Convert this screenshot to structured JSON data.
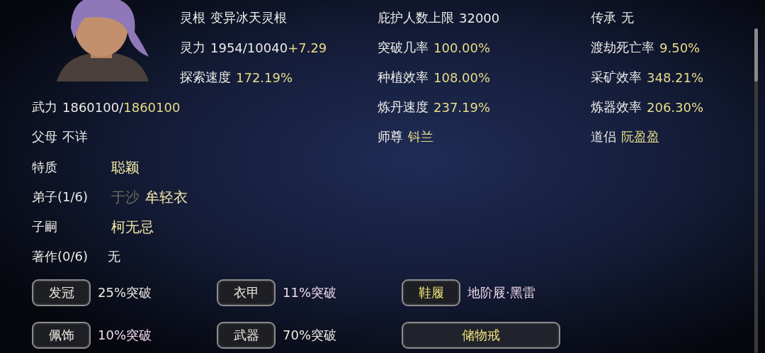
{
  "left_stats": [
    {
      "label": "灵根",
      "value": "变异冰天灵根"
    },
    {
      "label": "灵力",
      "value": "1954/10040",
      "accent": "+7.29"
    },
    {
      "label": "探索速度",
      "accent": "172.19%"
    },
    {
      "label": "武力",
      "value": "1860100/",
      "accent": "1860100"
    },
    {
      "label": "父母",
      "value": "不详"
    }
  ],
  "middle_stats": [
    {
      "label": "庇护人数上限",
      "value": "32000"
    },
    {
      "label": "突破几率",
      "accent": "100.00%"
    },
    {
      "label": "种植效率",
      "accent": "108.00%"
    },
    {
      "label": "炼丹速度",
      "accent": "237.19%"
    },
    {
      "label": "师尊",
      "accent": "钭兰"
    }
  ],
  "right_stats": [
    {
      "label": "传承",
      "value": "无"
    },
    {
      "label": "渡劫死亡率",
      "accent": "9.50%"
    },
    {
      "label": "采矿效率",
      "accent": "348.21%"
    },
    {
      "label": "炼器效率",
      "accent": "206.30%"
    },
    {
      "label": "道侣",
      "accent": "阮盈盈"
    }
  ],
  "relations": [
    {
      "label": "特质",
      "names": [
        {
          "text": "聪颖",
          "dimmed": false
        }
      ]
    },
    {
      "label": "弟子(1/6)",
      "names": [
        {
          "text": "于沙",
          "dimmed": true
        },
        {
          "text": "牟轻衣",
          "dimmed": false
        }
      ]
    },
    {
      "label": "子嗣",
      "names": [
        {
          "text": "柯无忌",
          "dimmed": false
        }
      ]
    },
    {
      "label": "著作(0/6)",
      "plain": "无"
    }
  ],
  "equipment": [
    {
      "kind": "slot",
      "label": "发冠",
      "highlighted": false,
      "value": "25%突破",
      "color": "#ece8e0"
    },
    {
      "kind": "slot",
      "label": "衣甲",
      "highlighted": false,
      "value": "11%突破",
      "color": "#f0d8ec"
    },
    {
      "kind": "slot",
      "label": "鞋履",
      "highlighted": true,
      "value": "地阶屐·黑雷",
      "color": "#f0d8ec"
    },
    {
      "kind": "slot",
      "label": "佩饰",
      "highlighted": false,
      "value": "10%突破",
      "color": "#f0d8ec"
    },
    {
      "kind": "slot",
      "label": "武器",
      "highlighted": false,
      "value": "70%突破",
      "color": "#ece8e0"
    },
    {
      "kind": "wide",
      "label": "储物戒",
      "highlighted": true
    }
  ]
}
